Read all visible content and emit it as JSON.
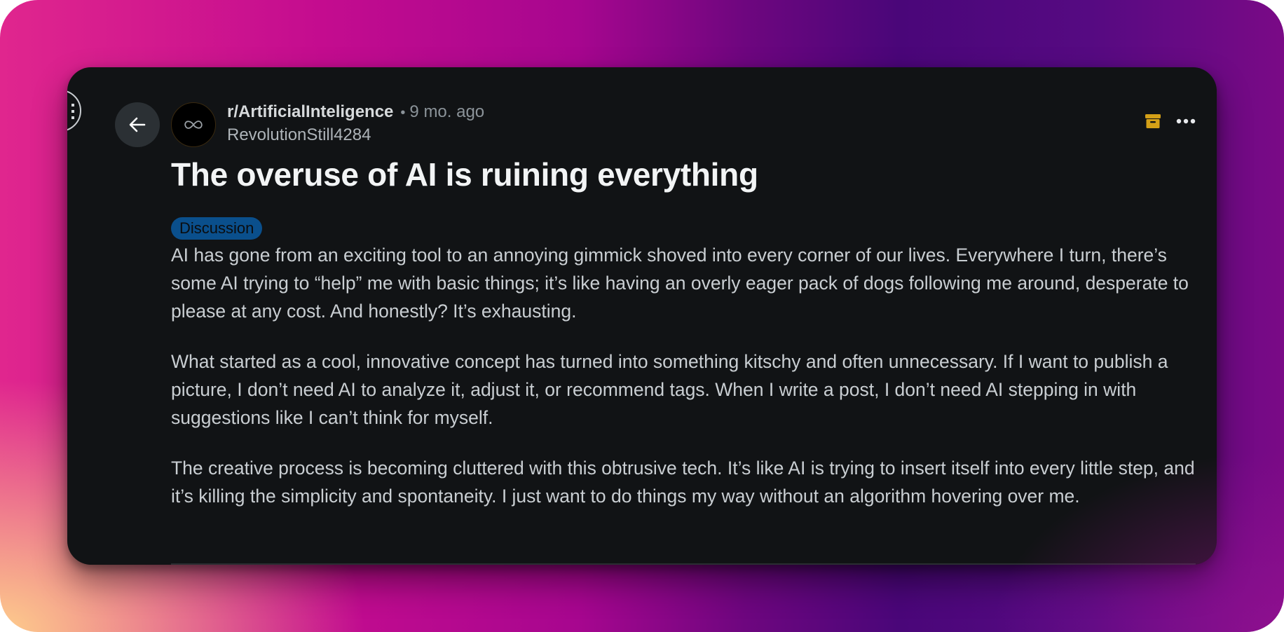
{
  "post": {
    "subreddit": "r/ArtificialInteligence",
    "separator": "•",
    "time_ago": "9 mo. ago",
    "author": "RevolutionStill4284",
    "title": "The overuse of AI is ruining everything",
    "flair": "Discussion",
    "paragraphs": [
      "AI has gone from an exciting tool to an annoying gimmick shoved into every corner of our lives. Everywhere I turn, there’s some AI trying to “help” me with basic things; it’s like having an overly eager pack of dogs following me around, desperate to please at any cost. And honestly? It’s exhausting.",
      "What started as a cool, innovative concept has turned into something kitschy and often unnecessary. If I want to publish a picture, I don’t need AI to analyze it, adjust it, or recommend tags. When I write a post, I don’t need AI stepping in with suggestions like I can’t think for myself.",
      "The creative process is becoming cluttered with this obtrusive tech. It’s like AI is trying to insert itself into every little step, and it’s killing the simplicity and spontaneity. I just want to do things my way without an algorithm hovering over me."
    ]
  },
  "icons": {
    "back": "arrow-left-icon",
    "avatar": "infinity-icon",
    "archive": "archive-box-icon",
    "more": "more-horizontal-icon",
    "side_menu": "menu-circle-icon"
  },
  "colors": {
    "card_background": "#111315",
    "flair_background": "#0a4f8c",
    "archive_icon": "#d4a017",
    "title_text": "#f2f4f5",
    "body_text": "#c9ced2"
  }
}
